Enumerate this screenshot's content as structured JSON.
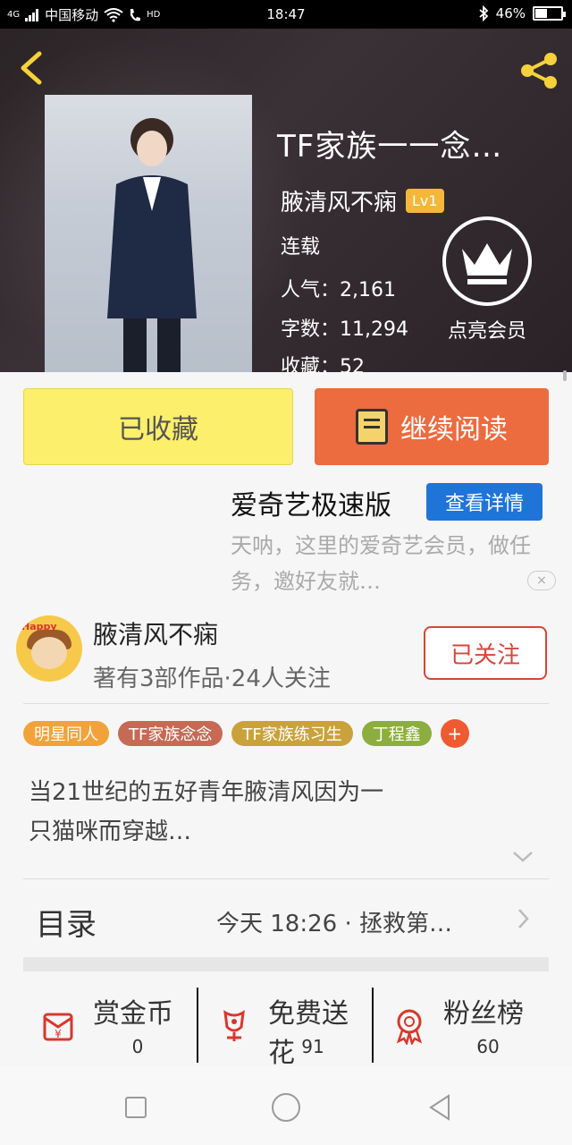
{
  "status_bar": {
    "network": "4G",
    "carrier": "中国移动",
    "hd": "HD",
    "time": "18:47",
    "battery": "46%",
    "battery_level": 0.46
  },
  "book": {
    "title": "TF家族一一念…",
    "author": "腋清风不痫",
    "level": "Lv1",
    "status": "连载",
    "popularity_label": "人气：",
    "popularity": "2,161",
    "words_label": "字数：",
    "words": "11,294",
    "collect_label": "收藏：",
    "collect": "52"
  },
  "vip": {
    "label": "点亮会员"
  },
  "actions": {
    "favorited": "已收藏",
    "continue_reading": "继续阅读"
  },
  "ad": {
    "title": "爱奇艺极速版",
    "button": "查看详情",
    "description": "天呐，这里的爱奇艺会员，做任务，邀好友就…",
    "close": "×"
  },
  "author_card": {
    "avatar_text": "Happy",
    "name": "腋清风不痫",
    "subtitle": "著有3部作品·24人关注",
    "follow_button": "已关注"
  },
  "tags": [
    {
      "label": "明星同人",
      "color": "#f2a23a"
    },
    {
      "label": "TF家族念念",
      "color": "#c66a55"
    },
    {
      "label": "TF家族练习生",
      "color": "#c9a23c"
    },
    {
      "label": "丁程鑫",
      "color": "#8cae3e"
    }
  ],
  "tag_more": "+",
  "description": "当21世纪的五好青年腋清风因为一只猫咪而穿越…",
  "toc": {
    "label": "目录",
    "latest": "今天 18:26 · 拯救第…"
  },
  "stats": [
    {
      "label": "赏金币",
      "value": "0",
      "icon": "reward-coin-icon"
    },
    {
      "label": "免费送花",
      "value": "91",
      "icon": "flower-icon"
    },
    {
      "label": "粉丝榜",
      "value": "60",
      "icon": "medal-icon"
    }
  ]
}
